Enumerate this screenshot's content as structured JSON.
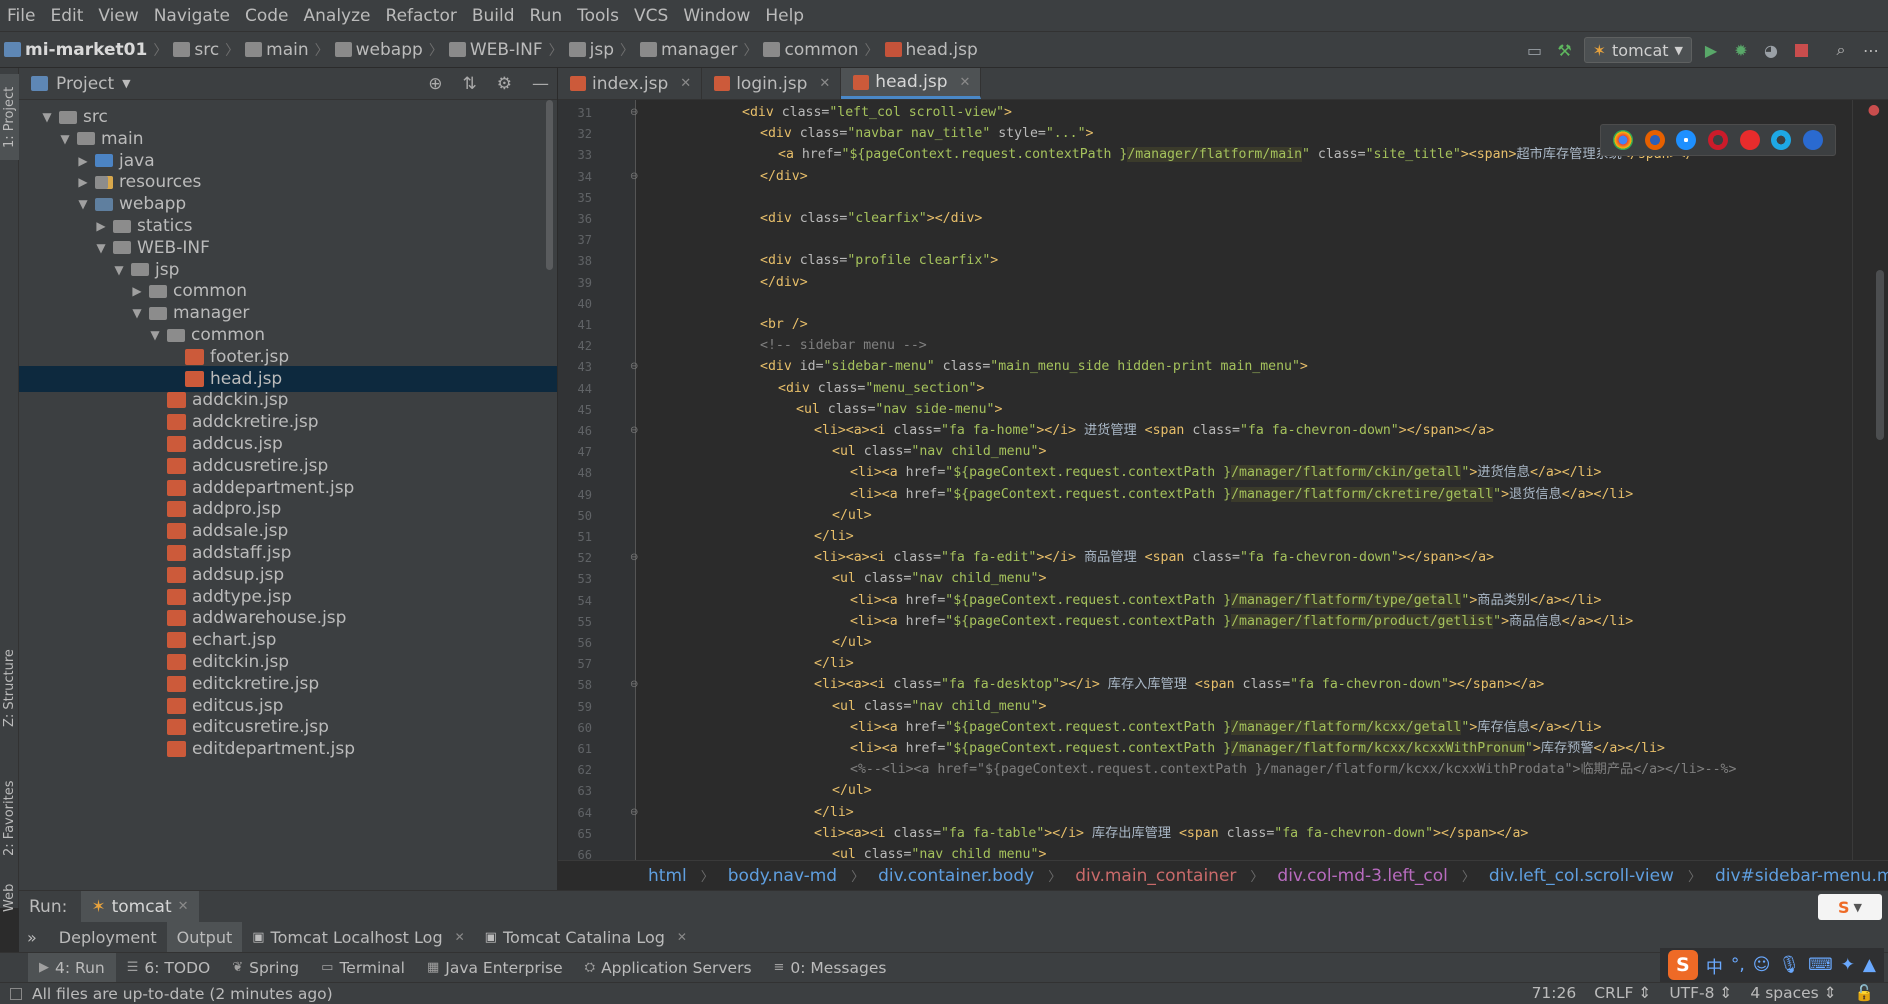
{
  "menu": [
    "File",
    "Edit",
    "View",
    "Navigate",
    "Code",
    "Analyze",
    "Refactor",
    "Build",
    "Run",
    "Tools",
    "VCS",
    "Window",
    "Help"
  ],
  "breadcrumb": [
    "mi-market01",
    "src",
    "main",
    "webapp",
    "WEB-INF",
    "jsp",
    "manager",
    "common",
    "head.jsp"
  ],
  "run_config": "tomcat",
  "project_panel": {
    "title": "Project"
  },
  "left_strip": [
    "1: Project",
    "Z: Structure",
    "2: Favorites",
    "Web"
  ],
  "tree": [
    {
      "label": "src",
      "depth": 1,
      "arrow": "▼",
      "icon": "src"
    },
    {
      "label": "main",
      "depth": 2,
      "arrow": "▼",
      "icon": "folder"
    },
    {
      "label": "java",
      "depth": 3,
      "arrow": "▶",
      "icon": "java"
    },
    {
      "label": "resources",
      "depth": 3,
      "arrow": "▶",
      "icon": "res"
    },
    {
      "label": "webapp",
      "depth": 3,
      "arrow": "▼",
      "icon": "web"
    },
    {
      "label": "statics",
      "depth": 4,
      "arrow": "▶",
      "icon": "folder"
    },
    {
      "label": "WEB-INF",
      "depth": 4,
      "arrow": "▼",
      "icon": "folder"
    },
    {
      "label": "jsp",
      "depth": 5,
      "arrow": "▼",
      "icon": "folder"
    },
    {
      "label": "common",
      "depth": 6,
      "arrow": "▶",
      "icon": "folder"
    },
    {
      "label": "manager",
      "depth": 6,
      "arrow": "▼",
      "icon": "folder"
    },
    {
      "label": "common",
      "depth": 7,
      "arrow": "▼",
      "icon": "folder"
    },
    {
      "label": "footer.jsp",
      "depth": 8,
      "arrow": "",
      "icon": "jsp"
    },
    {
      "label": "head.jsp",
      "depth": 8,
      "arrow": "",
      "icon": "jsp",
      "selected": true
    },
    {
      "label": "addckin.jsp",
      "depth": 7,
      "arrow": "",
      "icon": "jsp"
    },
    {
      "label": "addckretire.jsp",
      "depth": 7,
      "arrow": "",
      "icon": "jsp"
    },
    {
      "label": "addcus.jsp",
      "depth": 7,
      "arrow": "",
      "icon": "jsp"
    },
    {
      "label": "addcusretire.jsp",
      "depth": 7,
      "arrow": "",
      "icon": "jsp"
    },
    {
      "label": "adddepartment.jsp",
      "depth": 7,
      "arrow": "",
      "icon": "jsp"
    },
    {
      "label": "addpro.jsp",
      "depth": 7,
      "arrow": "",
      "icon": "jsp"
    },
    {
      "label": "addsale.jsp",
      "depth": 7,
      "arrow": "",
      "icon": "jsp"
    },
    {
      "label": "addstaff.jsp",
      "depth": 7,
      "arrow": "",
      "icon": "jsp"
    },
    {
      "label": "addsup.jsp",
      "depth": 7,
      "arrow": "",
      "icon": "jsp"
    },
    {
      "label": "addtype.jsp",
      "depth": 7,
      "arrow": "",
      "icon": "jsp"
    },
    {
      "label": "addwarehouse.jsp",
      "depth": 7,
      "arrow": "",
      "icon": "jsp"
    },
    {
      "label": "echart.jsp",
      "depth": 7,
      "arrow": "",
      "icon": "jsp"
    },
    {
      "label": "editckin.jsp",
      "depth": 7,
      "arrow": "",
      "icon": "jsp"
    },
    {
      "label": "editckretire.jsp",
      "depth": 7,
      "arrow": "",
      "icon": "jsp"
    },
    {
      "label": "editcus.jsp",
      "depth": 7,
      "arrow": "",
      "icon": "jsp"
    },
    {
      "label": "editcusretire.jsp",
      "depth": 7,
      "arrow": "",
      "icon": "jsp"
    },
    {
      "label": "editdepartment.jsp",
      "depth": 7,
      "arrow": "",
      "icon": "jsp"
    }
  ],
  "tabs": [
    {
      "label": "index.jsp",
      "active": false
    },
    {
      "label": "login.jsp",
      "active": false
    },
    {
      "label": "head.jsp",
      "active": true
    }
  ],
  "code_lines": [
    {
      "n": "31",
      "indent": 5,
      "parts": [
        [
          "tag",
          "<div "
        ],
        [
          "attr",
          "class="
        ],
        [
          "str",
          "\"left_col scroll-view\""
        ],
        [
          "tag",
          ">"
        ]
      ]
    },
    {
      "n": "32",
      "indent": 6,
      "parts": [
        [
          "tag",
          "<div "
        ],
        [
          "attr",
          "class="
        ],
        [
          "str",
          "\"navbar nav_title\" "
        ],
        [
          "attr",
          "style="
        ],
        [
          "str",
          "\"...\""
        ],
        [
          "tag",
          ">"
        ]
      ]
    },
    {
      "n": "33",
      "indent": 7,
      "parts": [
        [
          "tag",
          "<a "
        ],
        [
          "attr",
          "href="
        ],
        [
          "str",
          "\"${pageContext.request.contextPath }"
        ],
        [
          "el",
          "/manager/flatform/main"
        ],
        [
          "str",
          "\" "
        ],
        [
          "attr",
          "class="
        ],
        [
          "str",
          "\"site_title\""
        ],
        [
          "tag",
          ">"
        ],
        [
          "tag",
          "<span>"
        ],
        [
          "txt",
          "超市库存管理系统"
        ],
        [
          "tag",
          "</span></"
        ]
      ]
    },
    {
      "n": "34",
      "indent": 6,
      "parts": [
        [
          "tag",
          "</div>"
        ]
      ]
    },
    {
      "n": "35",
      "indent": 0,
      "parts": []
    },
    {
      "n": "36",
      "indent": 6,
      "parts": [
        [
          "tag",
          "<div "
        ],
        [
          "attr",
          "class="
        ],
        [
          "str",
          "\"clearfix\""
        ],
        [
          "tag",
          "></div>"
        ]
      ]
    },
    {
      "n": "37",
      "indent": 0,
      "parts": []
    },
    {
      "n": "38",
      "indent": 6,
      "parts": [
        [
          "tag",
          "<div "
        ],
        [
          "attr",
          "class="
        ],
        [
          "str",
          "\"profile clearfix\""
        ],
        [
          "tag",
          ">"
        ]
      ]
    },
    {
      "n": "39",
      "indent": 6,
      "parts": [
        [
          "tag",
          "</div>"
        ]
      ]
    },
    {
      "n": "40",
      "indent": 0,
      "parts": []
    },
    {
      "n": "41",
      "indent": 6,
      "parts": [
        [
          "tag",
          "<br />"
        ]
      ]
    },
    {
      "n": "42",
      "indent": 6,
      "parts": [
        [
          "com",
          "<!-- sidebar menu -->"
        ]
      ]
    },
    {
      "n": "43",
      "indent": 6,
      "parts": [
        [
          "tag",
          "<div "
        ],
        [
          "attr",
          "id="
        ],
        [
          "str",
          "\"sidebar-menu\" "
        ],
        [
          "attr",
          "class="
        ],
        [
          "str",
          "\"main_menu_side hidden-print main_menu\""
        ],
        [
          "tag",
          ">"
        ]
      ]
    },
    {
      "n": "44",
      "indent": 7,
      "parts": [
        [
          "tag",
          "<div "
        ],
        [
          "attr",
          "class="
        ],
        [
          "str",
          "\"menu_section\""
        ],
        [
          "tag",
          ">"
        ]
      ]
    },
    {
      "n": "45",
      "indent": 8,
      "parts": [
        [
          "tag",
          "<ul "
        ],
        [
          "attr",
          "class="
        ],
        [
          "str",
          "\"nav side-menu\""
        ],
        [
          "tag",
          ">"
        ]
      ]
    },
    {
      "n": "46",
      "indent": 9,
      "parts": [
        [
          "tag",
          "<li><a><i "
        ],
        [
          "attr",
          "class="
        ],
        [
          "str",
          "\"fa fa-home\""
        ],
        [
          "tag",
          "></i>"
        ],
        [
          "txt",
          " 进货管理 "
        ],
        [
          "tag",
          "<span "
        ],
        [
          "attr",
          "class="
        ],
        [
          "str",
          "\"fa fa-chevron-down\""
        ],
        [
          "tag",
          "></span></a>"
        ]
      ]
    },
    {
      "n": "47",
      "indent": 10,
      "parts": [
        [
          "tag",
          "<ul "
        ],
        [
          "attr",
          "class="
        ],
        [
          "str",
          "\"nav child_menu\""
        ],
        [
          "tag",
          ">"
        ]
      ]
    },
    {
      "n": "48",
      "indent": 11,
      "parts": [
        [
          "tag",
          "<li><a "
        ],
        [
          "attr",
          "href="
        ],
        [
          "str",
          "\"${pageContext.request.contextPath }"
        ],
        [
          "el",
          "/manager/flatform/ckin/getall"
        ],
        [
          "str",
          "\""
        ],
        [
          "tag",
          ">"
        ],
        [
          "txt",
          "进货信息"
        ],
        [
          "tag",
          "</a></li>"
        ]
      ]
    },
    {
      "n": "49",
      "indent": 11,
      "parts": [
        [
          "tag",
          "<li><a "
        ],
        [
          "attr",
          "href="
        ],
        [
          "str",
          "\"${pageContext.request.contextPath }"
        ],
        [
          "el",
          "/manager/flatform/ckretire/getall"
        ],
        [
          "str",
          "\""
        ],
        [
          "tag",
          ">"
        ],
        [
          "txt",
          "退货信息"
        ],
        [
          "tag",
          "</a></li>"
        ]
      ]
    },
    {
      "n": "50",
      "indent": 10,
      "parts": [
        [
          "tag",
          "</ul>"
        ]
      ]
    },
    {
      "n": "51",
      "indent": 9,
      "parts": [
        [
          "tag",
          "</li>"
        ]
      ]
    },
    {
      "n": "52",
      "indent": 9,
      "parts": [
        [
          "tag",
          "<li><a><i "
        ],
        [
          "attr",
          "class="
        ],
        [
          "str",
          "\"fa fa-edit\""
        ],
        [
          "tag",
          "></i>"
        ],
        [
          "txt",
          " 商品管理 "
        ],
        [
          "tag",
          "<span "
        ],
        [
          "attr",
          "class="
        ],
        [
          "str",
          "\"fa fa-chevron-down\""
        ],
        [
          "tag",
          "></span></a>"
        ]
      ]
    },
    {
      "n": "53",
      "indent": 10,
      "parts": [
        [
          "tag",
          "<ul "
        ],
        [
          "attr",
          "class="
        ],
        [
          "str",
          "\"nav child_menu\""
        ],
        [
          "tag",
          ">"
        ]
      ]
    },
    {
      "n": "54",
      "indent": 11,
      "parts": [
        [
          "tag",
          "<li><a "
        ],
        [
          "attr",
          "href="
        ],
        [
          "str",
          "\"${pageContext.request.contextPath }"
        ],
        [
          "el",
          "/manager/flatform/type/getall"
        ],
        [
          "str",
          "\""
        ],
        [
          "tag",
          ">"
        ],
        [
          "txt",
          "商品类别"
        ],
        [
          "tag",
          "</a></li>"
        ]
      ]
    },
    {
      "n": "55",
      "indent": 11,
      "parts": [
        [
          "tag",
          "<li><a "
        ],
        [
          "attr",
          "href="
        ],
        [
          "str",
          "\"${pageContext.request.contextPath }"
        ],
        [
          "el",
          "/manager/flatform/product/getlist"
        ],
        [
          "str",
          "\""
        ],
        [
          "tag",
          ">"
        ],
        [
          "txt",
          "商品信息"
        ],
        [
          "tag",
          "</a></li>"
        ]
      ]
    },
    {
      "n": "56",
      "indent": 10,
      "parts": [
        [
          "tag",
          "</ul>"
        ]
      ]
    },
    {
      "n": "57",
      "indent": 9,
      "parts": [
        [
          "tag",
          "</li>"
        ]
      ]
    },
    {
      "n": "58",
      "indent": 9,
      "parts": [
        [
          "tag",
          "<li><a><i "
        ],
        [
          "attr",
          "class="
        ],
        [
          "str",
          "\"fa fa-desktop\""
        ],
        [
          "tag",
          "></i>"
        ],
        [
          "txt",
          " 库存入库管理 "
        ],
        [
          "tag",
          "<span "
        ],
        [
          "attr",
          "class="
        ],
        [
          "str",
          "\"fa fa-chevron-down\""
        ],
        [
          "tag",
          "></span></a>"
        ]
      ]
    },
    {
      "n": "59",
      "indent": 10,
      "parts": [
        [
          "tag",
          "<ul "
        ],
        [
          "attr",
          "class="
        ],
        [
          "str",
          "\"nav child_menu\""
        ],
        [
          "tag",
          ">"
        ]
      ]
    },
    {
      "n": "60",
      "indent": 11,
      "parts": [
        [
          "tag",
          "<li><a "
        ],
        [
          "attr",
          "href="
        ],
        [
          "str",
          "\"${pageContext.request.contextPath }"
        ],
        [
          "el",
          "/manager/flatform/kcxx/getall"
        ],
        [
          "str",
          "\""
        ],
        [
          "tag",
          ">"
        ],
        [
          "txt",
          "库存信息"
        ],
        [
          "tag",
          "</a></li>"
        ]
      ]
    },
    {
      "n": "61",
      "indent": 11,
      "parts": [
        [
          "tag",
          "<li><a "
        ],
        [
          "attr",
          "href="
        ],
        [
          "str",
          "\"${pageContext.request.contextPath }"
        ],
        [
          "el",
          "/manager/flatform/kcxx/kcxxWithPronum"
        ],
        [
          "str",
          "\""
        ],
        [
          "tag",
          ">"
        ],
        [
          "txt",
          "库存预警"
        ],
        [
          "tag",
          "</a></li>"
        ]
      ]
    },
    {
      "n": "62",
      "indent": 11,
      "parts": [
        [
          "com",
          "<%--<li><a href=\"${pageContext.request.contextPath }/manager/flatform/kcxx/kcxxWithProdata\">临期产品</a></li>--%>"
        ]
      ]
    },
    {
      "n": "63",
      "indent": 10,
      "parts": [
        [
          "tag",
          "</ul>"
        ]
      ]
    },
    {
      "n": "64",
      "indent": 9,
      "parts": [
        [
          "tag",
          "</li>"
        ]
      ]
    },
    {
      "n": "65",
      "indent": 9,
      "parts": [
        [
          "tag",
          "<li><a><i "
        ],
        [
          "attr",
          "class="
        ],
        [
          "str",
          "\"fa fa-table\""
        ],
        [
          "tag",
          "></i>"
        ],
        [
          "txt",
          " 库存出库管理 "
        ],
        [
          "tag",
          "<span "
        ],
        [
          "attr",
          "class="
        ],
        [
          "str",
          "\"fa fa-chevron-down\""
        ],
        [
          "tag",
          "></span></a>"
        ]
      ]
    },
    {
      "n": "66",
      "indent": 10,
      "parts": [
        [
          "tag",
          "<ul "
        ],
        [
          "attr",
          "class="
        ],
        [
          "str",
          "\"nav child_menu\""
        ],
        [
          "tag",
          ">"
        ]
      ]
    }
  ],
  "editor_breadcrumb": [
    {
      "label": "html",
      "tone": "blue"
    },
    {
      "label": "body.nav-md",
      "tone": "blue"
    },
    {
      "label": "div.container.body",
      "tone": "blue"
    },
    {
      "label": "div.main_container",
      "tone": "red"
    },
    {
      "label": "div.col-md-3.left_col",
      "tone": "pink"
    },
    {
      "label": "div.left_col.scroll-view",
      "tone": "blue"
    },
    {
      "label": "div#sidebar-menu.main_menu_side.hidden-pri",
      "tone": "blue"
    }
  ],
  "run_panel": {
    "label": "Run:",
    "tab": "tomcat"
  },
  "run_subtabs": [
    {
      "label": "Deployment",
      "active": false,
      "closable": false
    },
    {
      "label": "Output",
      "active": true,
      "closable": false
    },
    {
      "label": "Tomcat Localhost Log",
      "active": false,
      "closable": true
    },
    {
      "label": "Tomcat Catalina Log",
      "active": false,
      "closable": true
    }
  ],
  "bottom_tools": [
    {
      "label": "4: Run",
      "icon": "run-icon",
      "active": true
    },
    {
      "label": "6: TODO",
      "icon": "todo-icon",
      "active": false
    },
    {
      "label": "Spring",
      "icon": "spring-icon",
      "active": false
    },
    {
      "label": "Terminal",
      "icon": "terminal-icon",
      "active": false
    },
    {
      "label": "Java Enterprise",
      "icon": "java-enterprise-icon",
      "active": false
    },
    {
      "label": "Application Servers",
      "icon": "app-servers-icon",
      "active": false
    },
    {
      "label": "0: Messages",
      "icon": "messages-icon",
      "active": false
    }
  ],
  "status": {
    "message": "All files are up-to-date (2 minutes ago)",
    "position": "71:26",
    "line_sep": "CRLF",
    "encoding": "UTF-8",
    "indent": "4 spaces"
  },
  "ime": {
    "logo": "S",
    "mode": "中"
  }
}
